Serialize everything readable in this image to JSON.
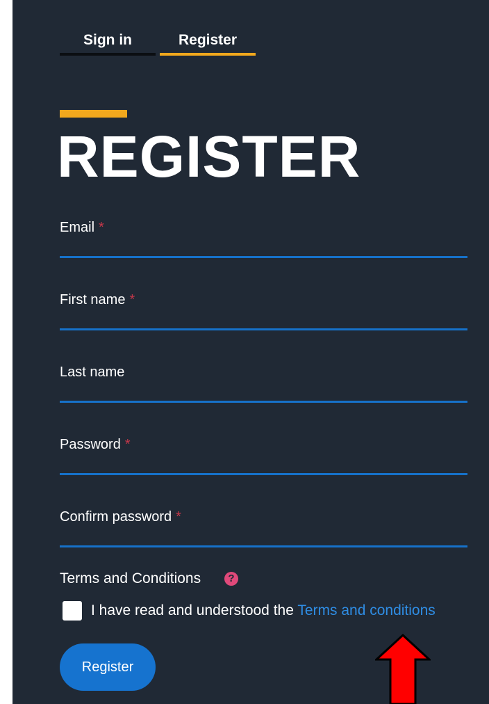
{
  "tabs": {
    "signin": "Sign in",
    "register": "Register"
  },
  "heading": "REGISTER",
  "fields": {
    "email": {
      "label": "Email",
      "required": "*",
      "value": ""
    },
    "first_name": {
      "label": "First name",
      "required": "*",
      "value": ""
    },
    "last_name": {
      "label": "Last name",
      "value": ""
    },
    "password": {
      "label": "Password",
      "required": "*",
      "value": ""
    },
    "confirm_password": {
      "label": "Confirm password",
      "required": "*",
      "value": ""
    }
  },
  "terms": {
    "title": "Terms and Conditions",
    "help_icon": "?",
    "checkbox_checked": false,
    "text": "I have read and understood the",
    "link": "Terms and conditions"
  },
  "register_button": "Register",
  "annotation": {
    "icon": "red-arrow-up-icon",
    "color": "#ff0000"
  },
  "colors": {
    "background": "#202935",
    "accent": "#f2a81d",
    "link": "#2f8de4",
    "button": "#1673cf"
  }
}
